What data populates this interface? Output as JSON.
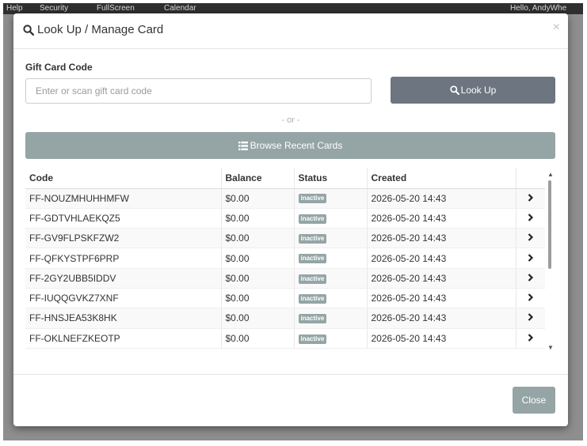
{
  "background": {
    "topbar_items": [
      "Help",
      "Security",
      "FullScreen",
      "Calendar",
      "Hello, AndyWhe"
    ]
  },
  "modal": {
    "title": "Look Up / Manage Card",
    "close_glyph": "×"
  },
  "form": {
    "label": "Gift Card Code",
    "placeholder": "Enter or scan gift card code",
    "value": "",
    "lookup_label": "Look Up",
    "or_text": "- or -",
    "browse_label": "Browse Recent Cards"
  },
  "table": {
    "columns": [
      "Code",
      "Balance",
      "Status",
      "Created",
      ""
    ],
    "rows": [
      {
        "code": "FF-NOUZMHUHHMFW",
        "balance": "$0.00",
        "status": "inactive",
        "created": "2026-05-20 14:43"
      },
      {
        "code": "FF-GDTVHLAEKQZ5",
        "balance": "$0.00",
        "status": "inactive",
        "created": "2026-05-20 14:43"
      },
      {
        "code": "FF-GV9FLPSKFZW2",
        "balance": "$0.00",
        "status": "inactive",
        "created": "2026-05-20 14:43"
      },
      {
        "code": "FF-QFKYSTPF6PRP",
        "balance": "$0.00",
        "status": "inactive",
        "created": "2026-05-20 14:43"
      },
      {
        "code": "FF-2GY2UBB5IDDV",
        "balance": "$0.00",
        "status": "inactive",
        "created": "2026-05-20 14:43"
      },
      {
        "code": "FF-IUQQGVKZ7XNF",
        "balance": "$0.00",
        "status": "inactive",
        "created": "2026-05-20 14:43"
      },
      {
        "code": "FF-HNSJEA53K8HK",
        "balance": "$0.00",
        "status": "inactive",
        "created": "2026-05-20 14:43"
      },
      {
        "code": "FF-OKLNEFZKEOTP",
        "balance": "$0.00",
        "status": "inactive",
        "created": "2026-05-20 14:43"
      }
    ]
  },
  "footer": {
    "close_label": "Close"
  },
  "icons": {
    "title_icon": "search-icon",
    "lookup_icon": "search-icon",
    "browse_icon": "list-icon",
    "row_action_icon": "chevron-right-icon"
  },
  "colors": {
    "primary_button": "#6c7580",
    "secondary_button": "#95a5a6",
    "badge": "#95a5a6"
  }
}
